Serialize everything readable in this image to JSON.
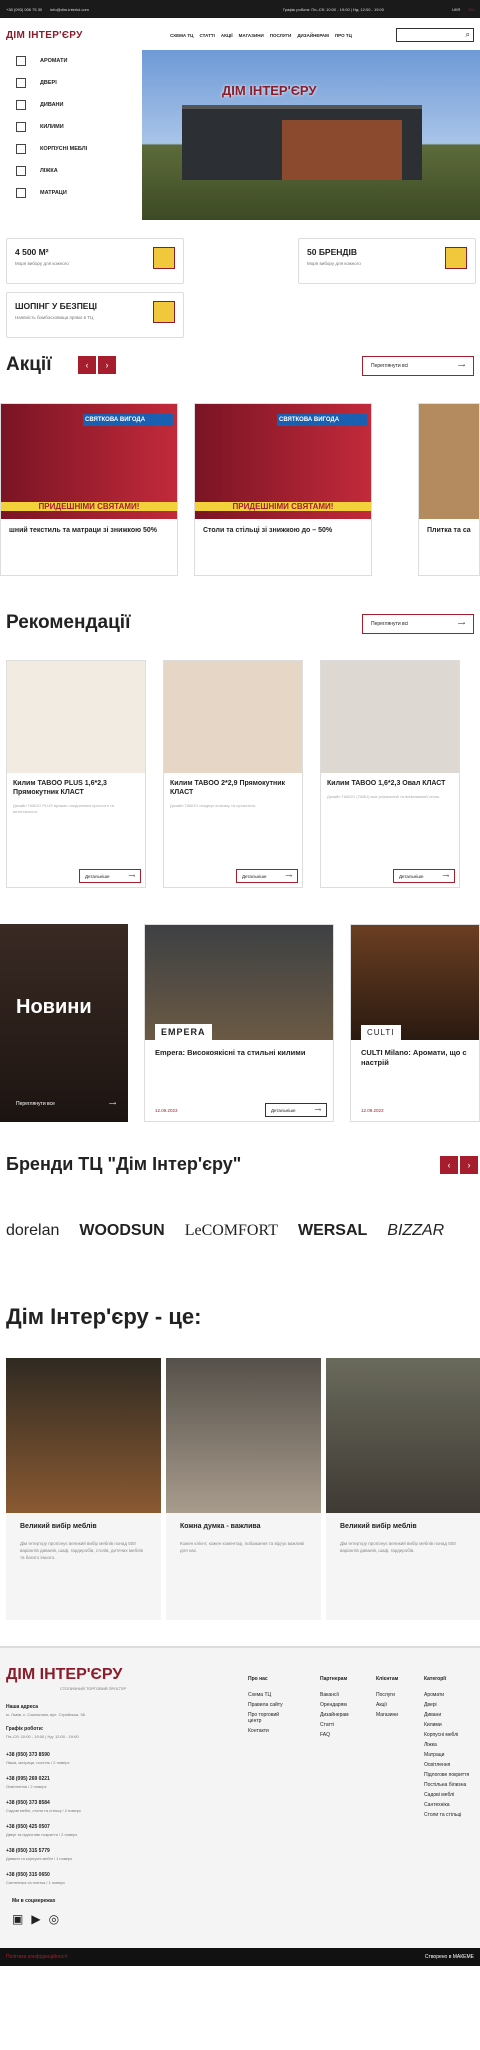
{
  "topbar": {
    "phone": "+38 (093) 006 75 30",
    "email": "info@dim-interiui.com",
    "hours": "Графік роботи: Пн–Сб: 10:00 - 19:00 | Нд: 12:00 - 19:00",
    "lang_ua": "UKR",
    "lang_en": "EN"
  },
  "header": {
    "logo": "ДІМ ІНТЕР'ЄРУ",
    "nav": [
      "СХЕМА ТЦ",
      "СТАТТІ",
      "АКЦІЇ",
      "МАГАЗИНИ",
      "ПОСЛУГИ",
      "ДИЗАЙНЕРАМ",
      "ПРО ТЦ"
    ],
    "search_icon": "search-icon"
  },
  "categories": [
    "АРОМАТИ",
    "ДВЕРІ",
    "ДИВАНИ",
    "КИЛИМИ",
    "КОРПУСНІ МЕБЛІ",
    "ЛІЖКА",
    "МАТРАЦИ"
  ],
  "hero": {
    "sign": "ДІМ ІНТЕР'ЄРУ"
  },
  "features": [
    {
      "title": "4 500 М²",
      "sub": "Моря вибору для кожного"
    },
    {
      "title": "50 БРЕНДІВ",
      "sub": "Моря вибору для кожного"
    },
    {
      "title": "ШОПІНГ У БЕЗПЕЦІ",
      "sub": "Наявність бомбосховища прямо в ТЦ"
    }
  ],
  "promos": {
    "title": "Акції",
    "see_all": "Переглянути всі",
    "items": [
      {
        "label": "шний текстиль та матраци зі знижкою 50%",
        "badge": "СВЯТКОВА ВИГОДА",
        "banner": "ПРИДЕШНІМИ СВЯТАМИ!"
      },
      {
        "label": "Столи та стільці зі знижкою до – 50%",
        "badge": "СВЯТКОВА ВИГОДА",
        "banner": "ПРИДЕШНІМИ СВЯТАМИ!"
      },
      {
        "label": "Плитка та са",
        "badge": "",
        "banner": ""
      }
    ]
  },
  "recommend": {
    "title": "Рекомендації",
    "see_all": "Переглянути всі",
    "more": "Детальніше",
    "items": [
      {
        "title": "Килим TABOO PLUS 1,6*2,3 Прямокутник КЛАСТ",
        "desc": "Дизайн TABOO PLUS вражає поєднанням простоти та витонченості."
      },
      {
        "title": "Килим TABOO 2*2,9 Прямокутник КЛАСТ",
        "desc": "Дизайн TABOO поєднує класику та сучасність."
      },
      {
        "title": "Килим TABOO 1,6*2,3 Овал КЛАСТ",
        "desc": "Дизайн TABOO (TABU) має унікальний та впізнаваний стиль."
      }
    ]
  },
  "news": {
    "title": "Новини",
    "see_all": "Переглянути все",
    "more": "Детальніше",
    "items": [
      {
        "title": "Empera: Високоякісні та стильні килими",
        "date": "12.09.2023",
        "brand": "EMPERA"
      },
      {
        "title": "CULTI Milano: Аромати, що с настрій",
        "date": "12.09.2023",
        "brand": "CULTI"
      }
    ]
  },
  "brands": {
    "title": "Бренди ТЦ \"Дім Інтер'єру\"",
    "items": [
      "dorelan",
      "WOODSUN",
      "LeCOMFORT",
      "WERSAL",
      "BIZZAR"
    ]
  },
  "advantages": {
    "title": "Дім Інтер'єру - це:",
    "items": [
      {
        "title": "Великий вибір меблів",
        "desc": "Дім Інтер'єру пропонує великий вибір меблів понад 500 варіантів диванів, шаф, гардеробів, столів, дитячих меблів та багато іншого."
      },
      {
        "title": "Кожна думка - важлива",
        "desc": "Кожен клієнт, кожен коментар, побажання та відгук важливі для нас."
      },
      {
        "title": "Великий вибір меблів",
        "desc": "Дім Інтер'єру пропонує великий вибір меблів понад 500 варіантів диванів, шаф, гардеробів."
      }
    ]
  },
  "footer": {
    "logo": "ДІМ ІНТЕР'ЄРУ",
    "tagline": "СТОЛИЧНИЙ ТОРГОВИЙ ПРОСТІР",
    "address_label": "Наша адреса",
    "address": "м. Львів, с. Сокільники, вул. Стрийська, 38",
    "hours_label": "Графік роботи:",
    "hours": "Пн–Сб: 10:00 - 19:00 | Нд: 12:00 - 19:00",
    "phones": [
      {
        "n": "+38 (050) 373 8590",
        "d": "Ліжка, матраци, постіль / 2 поверх"
      },
      {
        "n": "+38 (095) 269 0221",
        "d": "Освітлення / 2 поверх"
      },
      {
        "n": "+38 (050) 373 8584",
        "d": "Садові меблі, столи та стільці / 2 поверх"
      },
      {
        "n": "+38 (050) 425 0507",
        "d": "Двері та підлогове покриття / 2 поверх"
      },
      {
        "n": "+38 (050) 315 5779",
        "d": "Дивани та корпусні меблі / 1 поверх"
      },
      {
        "n": "+38 (050) 315 0650",
        "d": "Сантехніка та плитка / 1 поверх"
      }
    ],
    "social_label": "Ми в соцмережах",
    "cols": [
      {
        "h": "Про нас",
        "items": [
          "Схема ТЦ",
          "Правила сайту",
          "Про торговий центр",
          "Контакти"
        ]
      },
      {
        "h": "Партнерам",
        "items": [
          "Вакансії",
          "Орендарям",
          "Дизайнерам",
          "Статті",
          "FAQ"
        ]
      },
      {
        "h": "Клієнтам",
        "items": [
          "Послуги",
          "Акції",
          "Магазини"
        ]
      },
      {
        "h": "Категорії",
        "items": [
          "Аромати",
          "Двері",
          "Дивани",
          "Килими",
          "Корпусні меблі",
          "Ліжка",
          "Матраци",
          "Освітлення",
          "Підлогове покриття",
          "Постільна білизна",
          "Садові меблі",
          "Сантехніка",
          "Столи та стільці"
        ]
      }
    ],
    "privacy": "Політика конфіденційності",
    "created": "Створено в МАКЕМЕ"
  }
}
